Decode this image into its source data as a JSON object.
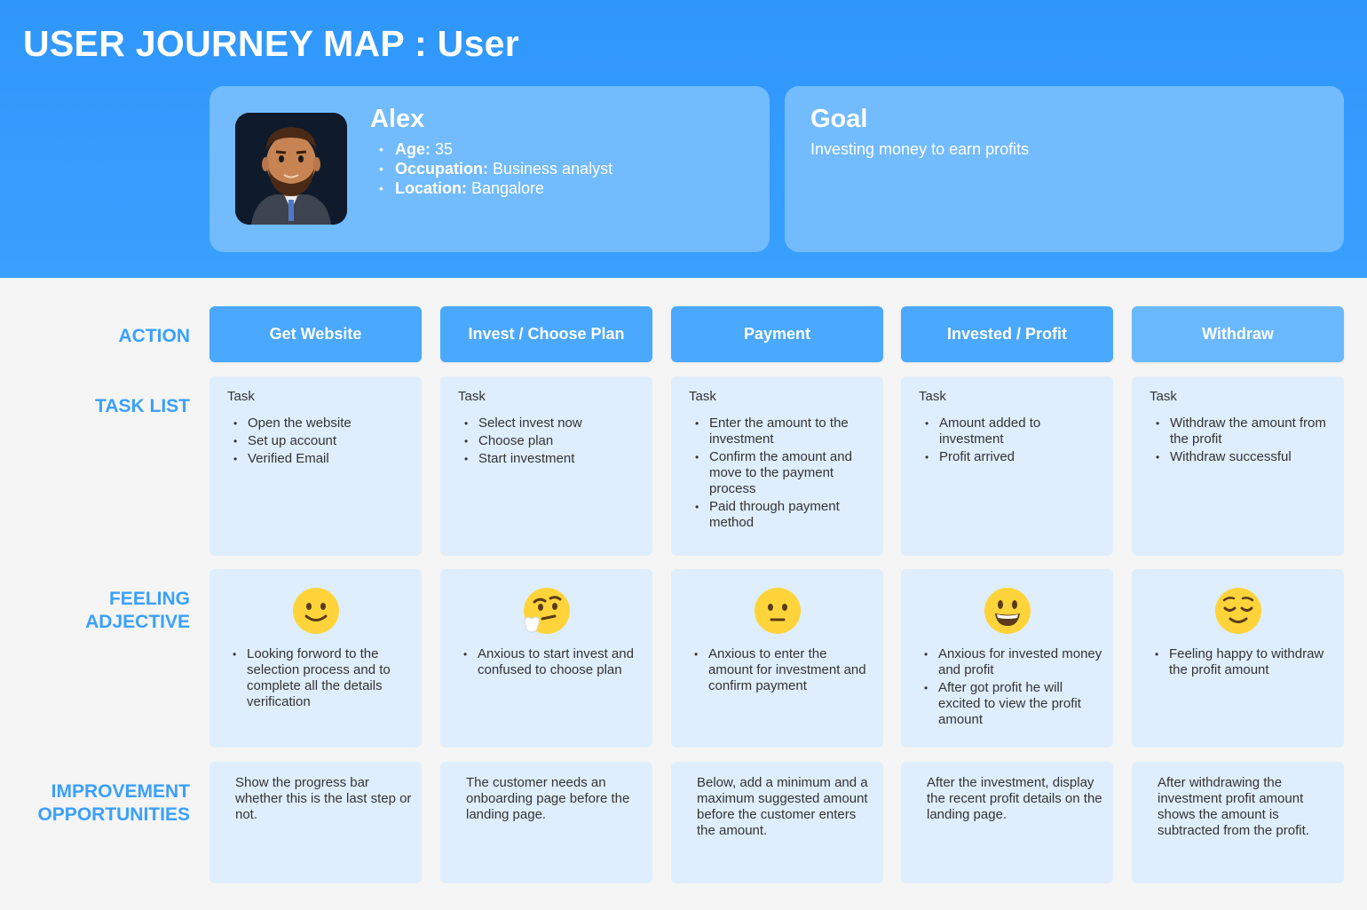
{
  "title": "USER JOURNEY MAP : User",
  "persona": {
    "name": "Alex",
    "details": [
      {
        "label": "Age:",
        "value": " 35"
      },
      {
        "label": "Occupation:",
        "value": " Business analyst"
      },
      {
        "label": "Location:",
        "value": " Bangalore"
      }
    ]
  },
  "goal": {
    "title": "Goal",
    "text": "Investing money to earn profits"
  },
  "row_labels": {
    "action": "ACTION",
    "task_list": "TASK LIST",
    "feeling": [
      "FEELING",
      "ADJECTIVE"
    ],
    "improvement": [
      "IMPROVEMENT",
      "OPPORTUNITIES"
    ]
  },
  "colors": {
    "header": "#3aa0ff",
    "card": "#72bbfd",
    "action": "#4aa8fd",
    "cell": "#dfeefd",
    "label": "#3aa0ff"
  },
  "stages": [
    {
      "action": "Get Website",
      "task_heading": "Task",
      "tasks": [
        "Open the website",
        "Set up account",
        "Verified Email"
      ],
      "emoji": "slightly-smiling-face-icon",
      "feelings": [
        "Looking forword to the selection process and to complete all the details verification"
      ],
      "improvement": "Show the progress bar whether this is the last step or not."
    },
    {
      "action": "Invest / Choose Plan",
      "task_heading": "Task",
      "tasks": [
        "Select invest now",
        "Choose plan",
        "Start investment"
      ],
      "emoji": "thinking-face-icon",
      "feelings": [
        "Anxious to start invest and confused to choose plan"
      ],
      "improvement": "The customer needs an onboarding page before the landing page."
    },
    {
      "action": "Payment",
      "task_heading": "Task",
      "tasks": [
        "Enter the amount to the investment",
        "Confirm the amount and move to the payment process",
        "Paid through payment method"
      ],
      "emoji": "neutral-face-icon",
      "feelings": [
        "Anxious to enter the amount for investment and confirm payment"
      ],
      "improvement": "Below, add a minimum and a maximum suggested amount before the customer enters the amount."
    },
    {
      "action": "Invested / Profit",
      "task_heading": "Task",
      "tasks": [
        "Amount added to investment",
        "Profit arrived"
      ],
      "emoji": "grinning-face-icon",
      "feelings": [
        "Anxious for invested money and profit",
        "After got profit he will excited to view the profit amount"
      ],
      "improvement": "After the investment, display the recent profit details on the landing page."
    },
    {
      "action": "Withdraw",
      "task_heading": "Task",
      "tasks": [
        "Withdraw the amount from the profit",
        "Withdraw successful"
      ],
      "emoji": "relieved-face-icon",
      "feelings": [
        "Feeling happy to withdraw the profit amount"
      ],
      "improvement": "After withdrawing the investment profit amount shows the amount is subtracted from the profit."
    }
  ]
}
